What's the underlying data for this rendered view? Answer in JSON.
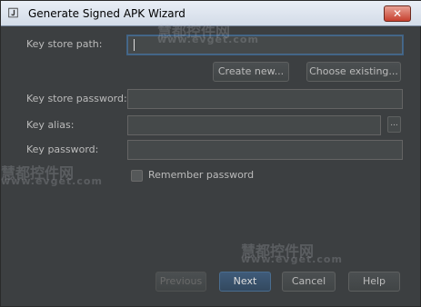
{
  "window": {
    "title": "Generate Signed APK Wizard",
    "close_glyph": "✕",
    "icon_glyph": "🄹"
  },
  "form": {
    "key_store_path_label": "Key store path:",
    "key_store_path_value": "",
    "create_new_label": "Create new...",
    "choose_existing_label": "Choose existing...",
    "key_store_password_label": "Key store password:",
    "key_alias_label": "Key alias:",
    "browse_label": "...",
    "key_password_label": "Key password:",
    "remember_password_label": "Remember password"
  },
  "footer": {
    "previous_label": "Previous",
    "next_label": "Next",
    "cancel_label": "Cancel",
    "help_label": "Help"
  },
  "watermark": {
    "brand": "慧都控件网",
    "url": "www.evget.com"
  }
}
